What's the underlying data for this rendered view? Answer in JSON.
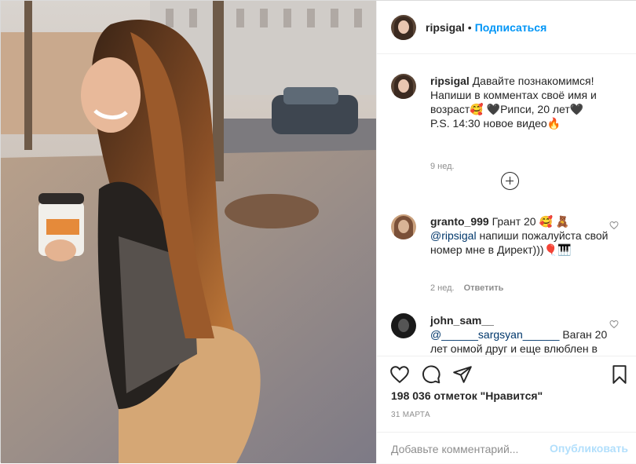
{
  "post": {
    "username": "ripsigal",
    "dot": "•",
    "follow_label": "Подписаться",
    "caption_line1": "Давайте познакомимся! Напиши в комментах своё имя и возраст",
    "caption_line2": "Рипси, 20 лет",
    "caption_line3": "P.S. 14:30 новое видео",
    "caption_emoji1": "🥰",
    "caption_emoji2": "🖤",
    "caption_emoji3": "🖤",
    "caption_emoji4": "🔥",
    "caption_time": "9 нед.",
    "likes": "198 036 отметок \"Нравится\"",
    "date": "31 МАРТА",
    "add_comment_placeholder": "Добавьте комментарий...",
    "publish_label": "Опубликовать"
  },
  "comments": [
    {
      "username": "granto_999",
      "text": "Грант 20 🥰 🧸",
      "mention": "@ripsigal",
      "text2": "напиши пожалуйста свой номер мне в Директ)))🎈🎹",
      "time": "2 нед.",
      "reply_label": "Ответить"
    },
    {
      "username": "john_sam__",
      "mention": "@______sargsyan______",
      "text2": "Ваган 20 лет онмой друг и еще влюблен в"
    }
  ],
  "icons": {
    "more": "plus-circle-icon",
    "like": "heart-icon",
    "comment": "comment-icon",
    "share": "send-icon",
    "save": "bookmark-icon"
  },
  "colors": {
    "accent": "#0095f6",
    "publish_disabled": "#b2dffc",
    "text": "#262626",
    "muted": "#8e8e8e"
  }
}
